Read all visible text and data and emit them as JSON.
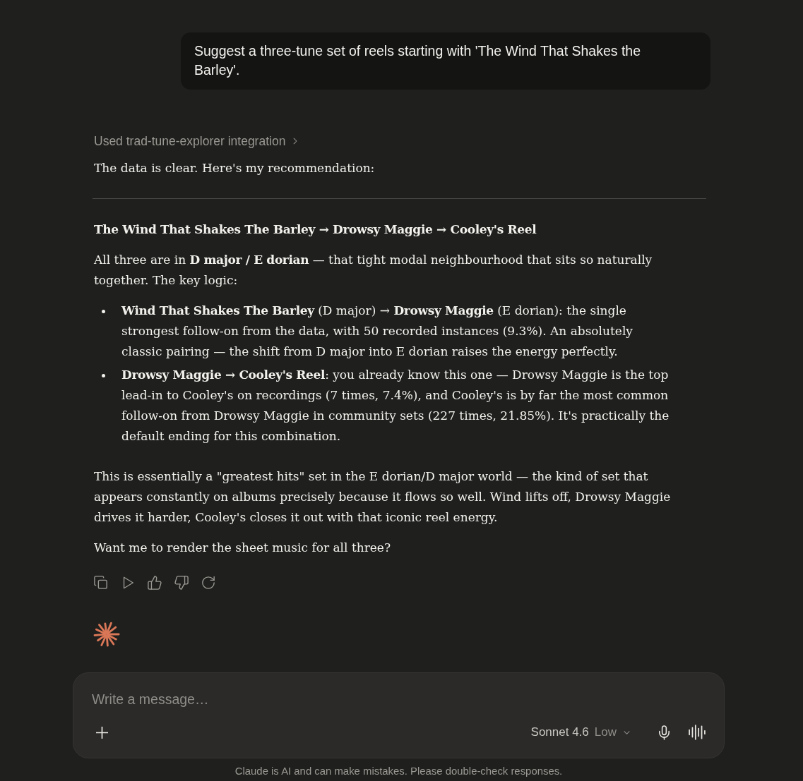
{
  "user_message": {
    "text": "Suggest a three-tune set of reels starting with 'The Wind That Shakes the Barley'."
  },
  "assistant": {
    "tool_call": {
      "label": "Used trad-tune-explorer integration",
      "expanded": false
    },
    "blocks": [
      {
        "kind": "paragraph",
        "text": "The data is clear. Here's my recommendation:"
      },
      {
        "kind": "rule"
      },
      {
        "kind": "heading",
        "text": "The Wind That Shakes The Barley → Drowsy Maggie → Cooley's Reel"
      },
      {
        "kind": "paragraph",
        "text": "All three are in **D major / E dorian** — that tight modal neighbourhood that sits so naturally together. The key logic:"
      },
      {
        "kind": "list",
        "items": [
          "**Wind That Shakes The Barley** (D major) → **Drowsy Maggie** (E dorian): the single strongest follow-on from the data, with 50 recorded instances (9.3%). An absolutely classic pairing — the shift from D major into E dorian raises the energy perfectly.",
          "**Drowsy Maggie → Cooley's Reel**: you already know this one — Drowsy Maggie is the top lead-in to Cooley's on recordings (7 times, 7.4%), and Cooley's is by far the most common follow-on from Drowsy Maggie in community sets (227 times, 21.85%). It's practically the default ending for this combination."
        ]
      },
      {
        "kind": "paragraph",
        "text": "This is essentially a \"greatest hits\" set in the E dorian/D major world — the kind of set that appears constantly on albums precisely because it flows so well. Wind lifts off, Drowsy Maggie drives it harder, Cooley's closes it out with that iconic reel energy."
      },
      {
        "kind": "paragraph",
        "text": "Want me to render the sheet music for all three?"
      }
    ]
  },
  "composer": {
    "placeholder": "Write a message…",
    "model": "Sonnet 4.6",
    "effort": "Low"
  },
  "disclaimer": "Claude is AI and can make mistakes. Please double-check responses."
}
